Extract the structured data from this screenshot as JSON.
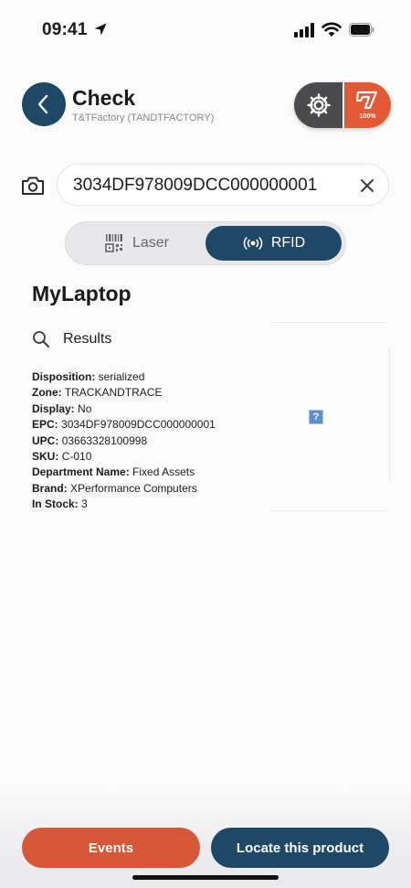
{
  "status_bar": {
    "time": "09:41"
  },
  "header": {
    "title": "Check",
    "subtitle": "T&TFactory (TANDTFACTORY)",
    "battery_percent": "100%"
  },
  "search": {
    "value": "3034DF978009DCC000000001"
  },
  "scan_mode": {
    "options": [
      {
        "label": "Laser",
        "selected": false
      },
      {
        "label": "RFID",
        "selected": true
      }
    ]
  },
  "product": {
    "name": "MyLaptop",
    "results_label": "Results",
    "details": [
      {
        "key": "Disposition:",
        "value": "serialized"
      },
      {
        "key": "Zone:",
        "value": "TRACKANDTRACE"
      },
      {
        "key": "Display:",
        "value": "No"
      },
      {
        "key": "EPC:",
        "value": "3034DF978009DCC000000001"
      },
      {
        "key": "UPC:",
        "value": "03663328100998"
      },
      {
        "key": "SKU:",
        "value": "C-010"
      },
      {
        "key": "Department Name:",
        "value": "Fixed Assets"
      },
      {
        "key": "Brand:",
        "value": "XPerformance Computers"
      },
      {
        "key": "In Stock:",
        "value": "3"
      }
    ],
    "image_placeholder": "?"
  },
  "actions": {
    "events_label": "Events",
    "locate_label": "Locate this product"
  },
  "colors": {
    "primary_navy": "#1f4766",
    "accent_orange": "#e35a35",
    "settings_gray": "#4b4b4d"
  },
  "icons": [
    "location-arrow-icon",
    "signal-icon",
    "wifi-icon",
    "battery-icon",
    "chevron-left-icon",
    "gear-icon",
    "brand-logo-icon",
    "camera-icon",
    "clear-icon",
    "barcode-icon",
    "rfid-icon",
    "search-icon"
  ]
}
